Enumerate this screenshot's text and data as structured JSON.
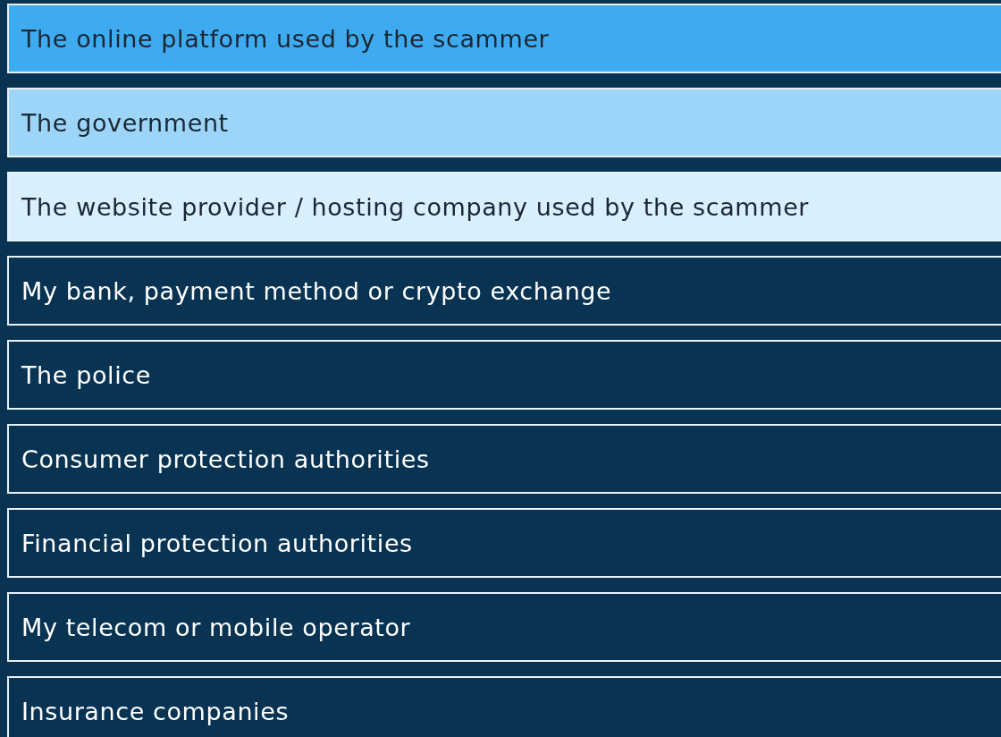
{
  "options": [
    {
      "label": "The online platform used by the scammer",
      "color": "#3eabf0"
    },
    {
      "label": "The government",
      "color": "#9dd5f8"
    },
    {
      "label": "The website provider / hosting company used by the scammer",
      "color": "#d9effd"
    },
    {
      "label": "My bank, payment method or crypto exchange",
      "color": "#083353"
    },
    {
      "label": "The police",
      "color": "#083353"
    },
    {
      "label": "Consumer protection authorities",
      "color": "#083353"
    },
    {
      "label": "Financial protection authorities",
      "color": "#083353"
    },
    {
      "label": "My telecom or mobile operator",
      "color": "#083353"
    },
    {
      "label": "Insurance companies",
      "color": "#083353"
    }
  ]
}
